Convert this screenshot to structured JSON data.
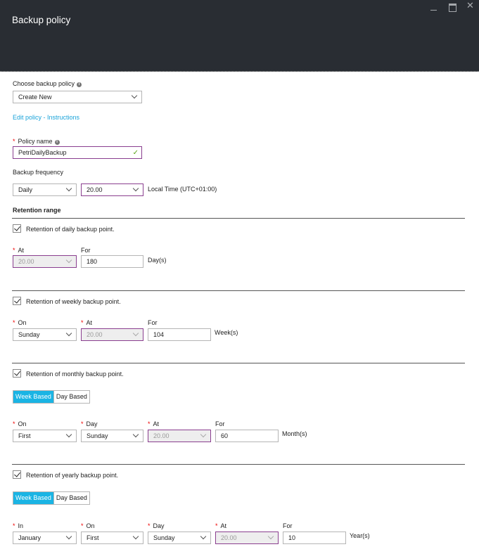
{
  "window": {
    "title": "Backup policy",
    "controls": [
      "minimize-icon",
      "maximize-icon",
      "close-icon"
    ]
  },
  "choose_policy": {
    "label": "Choose backup policy",
    "value": "Create New",
    "edit_link": "Edit policy - Instructions"
  },
  "policy_name": {
    "label": "Policy name",
    "value": "PetriDailyBackup",
    "valid": true
  },
  "frequency": {
    "label": "Backup frequency",
    "value": "Daily",
    "time": "20.00",
    "timezone": "Local Time (UTC+01:00)"
  },
  "retention": {
    "title": "Retention range",
    "daily": {
      "checkbox": "Retention of daily backup point.",
      "checked": true,
      "at_label": "At",
      "for_label": "For",
      "at": "20.00",
      "for": "180",
      "unit": "Day(s)"
    },
    "weekly": {
      "checkbox": "Retention of weekly backup point.",
      "checked": true,
      "on_label": "On",
      "at_label": "At",
      "for_label": "For",
      "on": "Sunday",
      "at": "20.00",
      "for": "104",
      "unit": "Week(s)"
    },
    "monthly": {
      "checkbox": "Retention of monthly backup point.",
      "checked": true,
      "toggle": [
        "Week Based",
        "Day Based"
      ],
      "selected_toggle": "Week Based",
      "on_label": "On",
      "day_label": "Day",
      "at_label": "At",
      "for_label": "For",
      "on": "First",
      "day": "Sunday",
      "at": "20.00",
      "for": "60",
      "unit": "Month(s)"
    },
    "yearly": {
      "checkbox": "Retention of yearly backup point.",
      "checked": true,
      "toggle": [
        "Week Based",
        "Day Based"
      ],
      "selected_toggle": "Week Based",
      "in_label": "In",
      "on_label": "On",
      "day_label": "Day",
      "at_label": "At",
      "for_label": "For",
      "in": "January",
      "on": "First",
      "day": "Sunday",
      "at": "20.00",
      "for": "10",
      "unit": "Year(s)"
    }
  },
  "colors": {
    "header_bg": "#292d33",
    "accent": "#1ab4e4",
    "link": "#1aa3d9",
    "required": "#e00000",
    "focus_border": "#8a3e8f",
    "valid": "#5ba518"
  }
}
